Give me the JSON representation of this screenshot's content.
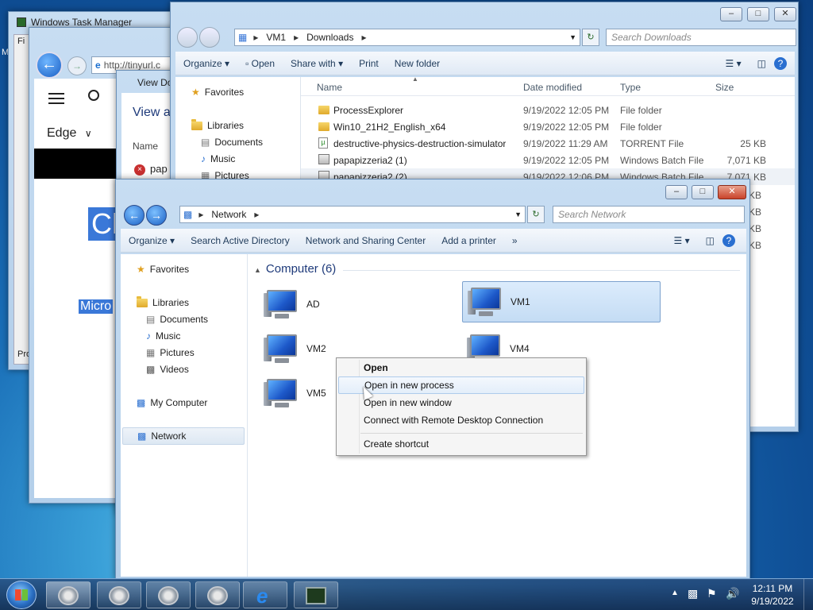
{
  "taskmgr": {
    "title": "Windows Task Manager",
    "menu_first": "Fi",
    "tab_stub": "Pro"
  },
  "ie": {
    "address": "http://tinyurl.c",
    "edge_label": "Edge",
    "hero_text": "Ch",
    "sub_text": "Micro"
  },
  "viewdl": {
    "title": "View Do",
    "heading": "View a",
    "col_name": "Name",
    "item": "pap"
  },
  "downloads": {
    "breadcrumb": [
      "VM1",
      "Downloads"
    ],
    "search_placeholder": "Search Downloads",
    "toolbar": [
      "Organize",
      "Open",
      "Share with",
      "Print",
      "New folder"
    ],
    "nav": [
      {
        "label": "Favorites"
      },
      {
        "label": "Libraries"
      },
      {
        "label": "Documents"
      },
      {
        "label": "Music"
      },
      {
        "label": "Pictures"
      }
    ],
    "columns": [
      "Name",
      "Date modified",
      "Type",
      "Size"
    ],
    "rows": [
      {
        "name": "ProcessExplorer",
        "date": "9/19/2022 12:05 PM",
        "type": "File folder",
        "size": ""
      },
      {
        "name": "Win10_21H2_English_x64",
        "date": "9/19/2022 12:05 PM",
        "type": "File folder",
        "size": ""
      },
      {
        "name": "destructive-physics-destruction-simulator",
        "date": "9/19/2022 11:29 AM",
        "type": "TORRENT File",
        "size": "25 KB"
      },
      {
        "name": "papapizzeria2 (1)",
        "date": "9/19/2022 12:05 PM",
        "type": "Windows Batch File",
        "size": "7,071 KB"
      },
      {
        "name": "papapizzeria2 (2)",
        "date": "9/19/2022 12:06 PM",
        "type": "Windows Batch File",
        "size": "7,071 KB"
      }
    ],
    "hidden_sizes": [
      "KB",
      "KB",
      "KB",
      "KB"
    ]
  },
  "network": {
    "breadcrumb": "Network",
    "search_placeholder": "Search Network",
    "toolbar": [
      "Organize",
      "Search Active Directory",
      "Network and Sharing Center",
      "Add a printer",
      "»"
    ],
    "nav": [
      "Favorites",
      "Libraries",
      "Documents",
      "Music",
      "Pictures",
      "Videos",
      "My Computer",
      "Network"
    ],
    "group_header": "Computer (6)",
    "computers": [
      "AD",
      "VM1",
      "VM2",
      "VM4",
      "VM5"
    ]
  },
  "context_menu": {
    "items": [
      "Open",
      "Open in new process",
      "Open in new window",
      "Connect with Remote Desktop Connection",
      "Create shortcut"
    ]
  },
  "taskbar": {
    "time": "12:11 PM",
    "date": "9/19/2022"
  }
}
